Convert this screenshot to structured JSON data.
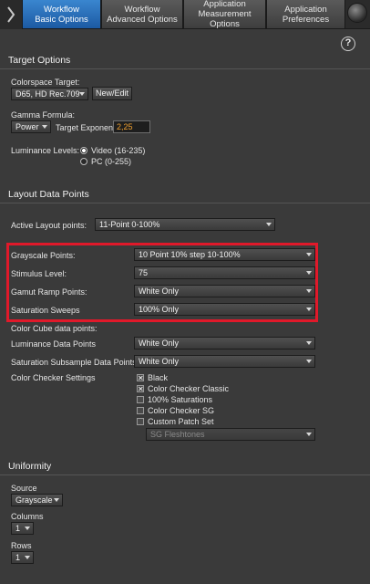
{
  "tabs": [
    {
      "line1": "Workflow",
      "line2": "Basic Options",
      "active": true
    },
    {
      "line1": "Workflow",
      "line2": "Advanced Options",
      "active": false
    },
    {
      "line1": "Application",
      "line2": "Measurement Options",
      "active": false
    },
    {
      "line1": "Application",
      "line2": "Preferences",
      "active": false
    }
  ],
  "help_label": "?",
  "target_options": {
    "title": "Target Options",
    "colorspace_label": "Colorspace Target:",
    "colorspace_value": "D65, HD Rec.709",
    "new_edit_label": "New/Edit",
    "gamma_label": "Gamma Formula:",
    "gamma_value": "Power",
    "target_exponent_label": "Target Exponent",
    "target_exponent_value": "2,25",
    "luminance_label": "Luminance Levels:",
    "luminance_options": [
      "Video (16-235)",
      "PC (0-255)"
    ],
    "luminance_selected": "Video (16-235)"
  },
  "layout_points": {
    "title": "Layout Data Points",
    "active_layout_label": "Active Layout points:",
    "active_layout_value": "11-Point 0-100%",
    "grayscale_label": "Grayscale Points:",
    "grayscale_value": "10 Point 10% step 10-100%",
    "stimulus_label": "Stimulus Level:",
    "stimulus_value": "75",
    "gamut_ramp_label": "Gamut Ramp Points:",
    "gamut_ramp_value": "White Only",
    "saturation_label": "Saturation Sweeps",
    "saturation_value": "100% Only",
    "color_cube_label": "Color Cube data points:",
    "luminance_dp_label": "Luminance Data Points",
    "luminance_dp_value": "White Only",
    "sat_subsample_label": "Saturation Subsample Data Points",
    "sat_subsample_value": "White Only",
    "color_checker_label": "Color Checker Settings",
    "color_checker_items": [
      {
        "label": "Black",
        "checked": true
      },
      {
        "label": "Color Checker Classic",
        "checked": true
      },
      {
        "label": "100% Saturations",
        "checked": false
      },
      {
        "label": "Color Checker SG",
        "checked": false
      },
      {
        "label": "Custom Patch Set",
        "checked": false
      }
    ],
    "patch_set_value": "SG Fleshtones"
  },
  "uniformity": {
    "title": "Uniformity",
    "source_label": "Source",
    "source_value": "Grayscale",
    "columns_label": "Columns",
    "columns_value": "1",
    "rows_label": "Rows",
    "rows_value": "1"
  },
  "colors": {
    "active_tab": "#2a70bd",
    "highlight_box": "#e0192a",
    "exponent_text": "#f0a030"
  }
}
